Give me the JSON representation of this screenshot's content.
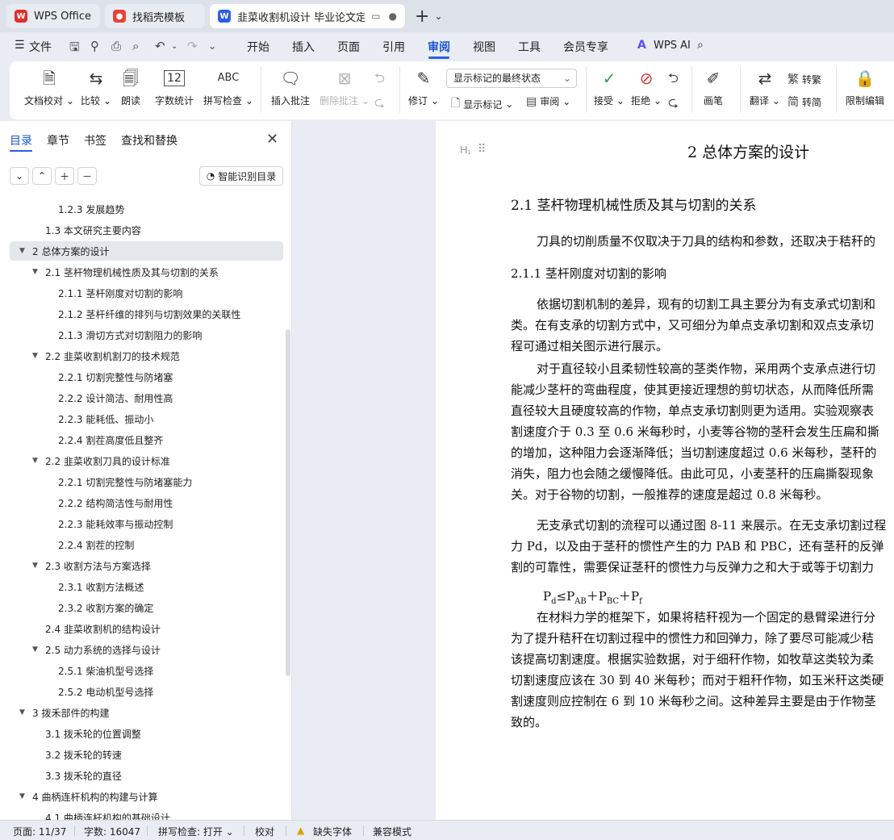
{
  "tabs": [
    {
      "label": "WPS Office",
      "icon": "wps-logo-icon",
      "state": "inactive"
    },
    {
      "label": "找稻壳模板",
      "icon": "docer-icon",
      "state": "inactive"
    },
    {
      "label": "韭菜收割机设计 毕业论文定稿",
      "icon": "word-doc-icon",
      "state": "active"
    }
  ],
  "new_tab_label": "+",
  "menu": {
    "file": "文件",
    "items": [
      "开始",
      "插入",
      "页面",
      "引用",
      "审阅",
      "视图",
      "工具",
      "会员专享"
    ],
    "active": "审阅",
    "wps_ai": "WPS AI"
  },
  "ribbon": {
    "doc_check": "文档校对",
    "compare": "比较",
    "read_aloud": "朗读",
    "word_count": "字数统计",
    "spell_check": "拼写检查",
    "spell_check_icon_text": "ABC",
    "word_count_icon_text": "12",
    "insert_comment": "插入批注",
    "delete_comment": "删除批注",
    "track_changes": "修订",
    "markup_mode": "显示标记的最终状态",
    "show_markup": "显示标记",
    "review_pane": "审阅",
    "accept": "接受",
    "reject": "拒绝",
    "ink": "画笔",
    "translate": "翻译",
    "to_traditional": "转繁",
    "to_simplified": "转简",
    "restrict_edit": "限制编辑"
  },
  "left_panel": {
    "tabs": [
      "目录",
      "章节",
      "书签",
      "查找和替换"
    ],
    "active_tab": "目录",
    "smart_toc_button": "智能识别目录",
    "toc": [
      {
        "text": "1.2.3  发展趋势",
        "level": 3,
        "expander": ""
      },
      {
        "text": "1.3  本文研究主要内容",
        "level": 2,
        "expander": ""
      },
      {
        "text": "2 总体方案的设计",
        "level": 1,
        "expander": "▼",
        "selected": true
      },
      {
        "text": "2.1 茎杆物理机械性质及其与切割的关系",
        "level": 2,
        "expander": "▼"
      },
      {
        "text": "2.1.1 茎杆刚度对切割的影响",
        "level": 3,
        "expander": ""
      },
      {
        "text": "2.1.2  茎杆纤维的排列与切割效果的关联性",
        "level": 3,
        "expander": ""
      },
      {
        "text": "2.1.3  滑切方式对切割阻力的影响",
        "level": 3,
        "expander": ""
      },
      {
        "text": "2.2  韭菜收割机割刀的技术规范",
        "level": 2,
        "expander": "▼"
      },
      {
        "text": "2.2.1  切割完整性与防堵塞",
        "level": 3,
        "expander": ""
      },
      {
        "text": "2.2.2  设计简洁、耐用性高",
        "level": 3,
        "expander": ""
      },
      {
        "text": "2.2.3  能耗低、振动小",
        "level": 3,
        "expander": ""
      },
      {
        "text": "2.2.4  割茬高度低且整齐",
        "level": 3,
        "expander": ""
      },
      {
        "text": "2.2  韭菜收割刀具的设计标准",
        "level": 2,
        "expander": "▼"
      },
      {
        "text": "2.2.1  切割完整性与防堵塞能力",
        "level": 3,
        "expander": ""
      },
      {
        "text": "2.2.2  结构简洁性与耐用性",
        "level": 3,
        "expander": ""
      },
      {
        "text": "2.2.3  能耗效率与振动控制",
        "level": 3,
        "expander": ""
      },
      {
        "text": "2.2.4  割茬的控制",
        "level": 3,
        "expander": ""
      },
      {
        "text": "2.3  收割方法与方案选择",
        "level": 2,
        "expander": "▼"
      },
      {
        "text": "2.3.1  收割方法概述",
        "level": 3,
        "expander": ""
      },
      {
        "text": "2.3.2  收割方案的确定",
        "level": 3,
        "expander": ""
      },
      {
        "text": "2.4  韭菜收割机的结构设计",
        "level": 2,
        "expander": ""
      },
      {
        "text": "2.5  动力系统的选择与设计",
        "level": 2,
        "expander": "▼"
      },
      {
        "text": "2.5.1  柴油机型号选择",
        "level": 3,
        "expander": ""
      },
      {
        "text": "2.5.2  电动机型号选择",
        "level": 3,
        "expander": ""
      },
      {
        "text": "3  拨禾部件的构建",
        "level": 1,
        "expander": "▼"
      },
      {
        "text": "3.1 拨禾轮的位置调整",
        "level": 2,
        "expander": ""
      },
      {
        "text": "3.2 拨禾轮的转速",
        "level": 2,
        "expander": ""
      },
      {
        "text": "3.3  拨禾轮的直径",
        "level": 2,
        "expander": ""
      },
      {
        "text": "4  曲柄连杆机构的构建与计算",
        "level": 1,
        "expander": "▼"
      },
      {
        "text": "4.1  曲柄连杆机构的基础设计",
        "level": 2,
        "expander": ""
      }
    ]
  },
  "document": {
    "heading_marker": "H₁",
    "chapter_title": "2 总体方案的设计",
    "section_title": "2.1 茎杆物理机械性质及其与切割的关系",
    "subsection_title": "2.1.1 茎杆刚度对切割的影响",
    "paragraphs": [
      {
        "text": "刀具的切削质量不仅取决于刀具的结构和参数，还取决于秸秆的",
        "indent": true
      },
      {
        "text": "依据切割机制的差异，现有的切割工具主要分为有支承式切割和",
        "indent": true
      },
      {
        "text": "类。在有支承的切割方式中，又可细分为单点支承切割和双点支承切",
        "indent": false
      },
      {
        "text": "程可通过相关图示进行展示。",
        "indent": false
      },
      {
        "text": "对于直径较小且柔韧性较高的茎类作物，采用两个支承点进行切",
        "indent": true
      },
      {
        "text": "能减少茎杆的弯曲程度，使其更接近理想的剪切状态，从而降低所需",
        "indent": false
      },
      {
        "text": "直径较大且硬度较高的作物，单点支承切割则更为适用。实验观察表",
        "indent": false
      },
      {
        "text": "割速度介于 0.3 至 0.6 米每秒时，小麦等谷物的茎秆会发生压扁和撕",
        "indent": false
      },
      {
        "text": "的增加，这种阻力会逐渐降低；当切割速度超过 0.6 米每秒，茎秆的",
        "indent": false
      },
      {
        "text": "消失，阻力也会随之缓慢降低。由此可见，小麦茎秆的压扁撕裂现象",
        "indent": false
      },
      {
        "text": "关。对于谷物的切割，一般推荐的速度是超过 0.8 米每秒。",
        "indent": false
      },
      {
        "text": "无支承式切割的流程可以通过图 8-11 来展示。在无支承切割过程",
        "indent": true
      },
      {
        "text": "力 Pd，以及由于茎秆的惯性产生的力 PAB 和 PBC，还有茎秆的反弹",
        "indent": false
      },
      {
        "text": "割的可靠性，需要保证茎秆的惯性力与反弹力之和大于或等于切割力",
        "indent": false
      },
      {
        "text": "在材料力学的框架下，如果将秸秆视为一个固定的悬臂梁进行分",
        "indent": true
      },
      {
        "text": "为了提升秸秆在切割过程中的惯性力和回弹力，除了要尽可能减少秸",
        "indent": false
      },
      {
        "text": "该提高切割速度。根据实验数据，对于细秆作物，如牧草这类较为柔",
        "indent": false
      },
      {
        "text": "切割速度应该在 30 到 40 米每秒；而对于粗秆作物，如玉米秆这类硬",
        "indent": false
      },
      {
        "text": "割速度则应控制在 6 到 10 米每秒之间。这种差异主要是由于作物茎",
        "indent": false
      },
      {
        "text": "致的。",
        "indent": false
      }
    ],
    "formula": {
      "p1": "P",
      "s1": "d",
      "op1": "≤P",
      "s2": "AB",
      "op2": "＋P",
      "s3": "BC",
      "op3": "＋P",
      "s4": "f"
    }
  },
  "status_bar": {
    "page": "页面: 11/37",
    "word_count": "字数: 16047",
    "spell_check": "拼写检查: 打开",
    "proofread": "校对",
    "missing_font": "缺失字体",
    "compat_mode": "兼容模式"
  }
}
